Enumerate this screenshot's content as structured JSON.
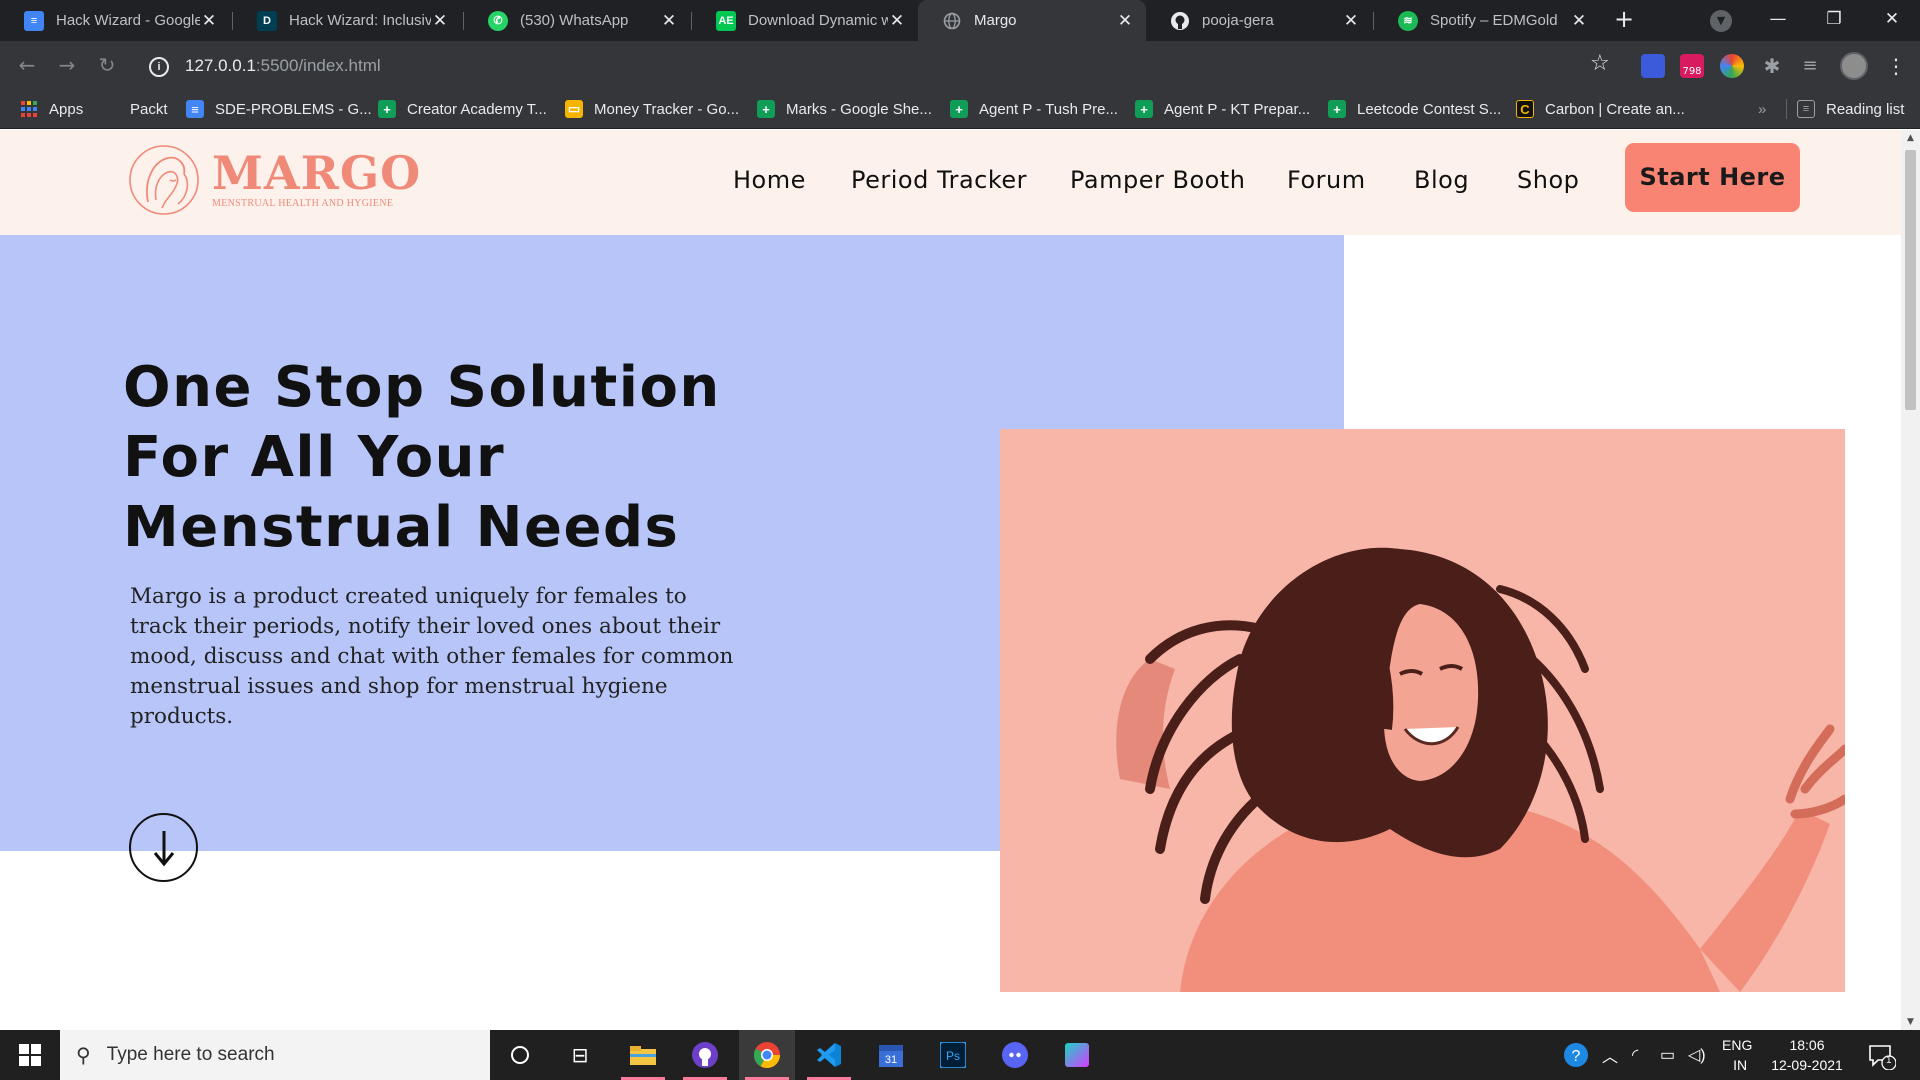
{
  "browser": {
    "tabs": [
      {
        "title": "Hack Wizard - Google",
        "favicon": "docs-icon",
        "color": "#4285f4"
      },
      {
        "title": "Hack Wizard: Inclusive",
        "favicon": "devpost-icon",
        "color": "#003e54"
      },
      {
        "title": "(530) WhatsApp",
        "favicon": "whatsapp-icon",
        "color": "#25d366"
      },
      {
        "title": "Download Dynamic w",
        "favicon": "ae-icon",
        "color": "#00c853"
      },
      {
        "title": "Margo",
        "favicon": "globe-icon",
        "color": "#9aa0a6",
        "active": true
      },
      {
        "title": "pooja-gera",
        "favicon": "github-icon",
        "color": "#ffffff"
      },
      {
        "title": "Spotify – EDMGold",
        "favicon": "spotify-icon",
        "color": "#1db954"
      }
    ],
    "url_host": "127.0.0.1",
    "url_path": ":5500/index.html",
    "extension_badge": "798",
    "bookmarks": [
      {
        "label": "Apps",
        "icon": "apps-grid-icon"
      },
      {
        "label": "Packt",
        "icon": "none"
      },
      {
        "label": "SDE-PROBLEMS - G...",
        "icon": "docs-icon",
        "color": "#4285f4"
      },
      {
        "label": "Creator Academy T...",
        "icon": "sheets-icon",
        "color": "#0f9d58"
      },
      {
        "label": "Money Tracker - Go...",
        "icon": "slides-icon",
        "color": "#f4b400"
      },
      {
        "label": "Marks - Google She...",
        "icon": "sheets-icon",
        "color": "#0f9d58"
      },
      {
        "label": "Agent P - Tush Pre...",
        "icon": "sheets-icon",
        "color": "#0f9d58"
      },
      {
        "label": "Agent P - KT Prepar...",
        "icon": "sheets-icon",
        "color": "#0f9d58"
      },
      {
        "label": "Leetcode Contest S...",
        "icon": "sheets-icon",
        "color": "#0f9d58"
      },
      {
        "label": "Carbon | Create an...",
        "icon": "carbon-icon",
        "color": "#111111"
      }
    ],
    "bookmarks_overflow": "»",
    "reading_list": "Reading list"
  },
  "site": {
    "logo_text": "MARGO",
    "logo_subtitle": "MENSTRUAL HEALTH AND HYGIENE",
    "nav": [
      "Home",
      "Period Tracker",
      "Pamper Booth",
      "Forum",
      "Blog",
      "Shop"
    ],
    "cta": "Start Here",
    "hero_title": "One Stop Solution For All Your Menstrual Needs",
    "hero_description": "Margo is a product created uniquely for females to track their periods, notify their loved ones about their mood, discuss and chat with other females for common menstrual issues and shop for menstrual hygiene products.",
    "colors": {
      "nav_bg": "#fdf1ec",
      "hero_bg": "#b7c5f8",
      "accent": "#fa8474",
      "logo": "#f08a78",
      "photo_tint": "#f8b2a4"
    }
  },
  "taskbar": {
    "search_placeholder": "Type here to search",
    "lang_top": "ENG",
    "lang_bottom": "IN",
    "time": "18:06",
    "date": "12-09-2021",
    "notification_count": "1"
  }
}
